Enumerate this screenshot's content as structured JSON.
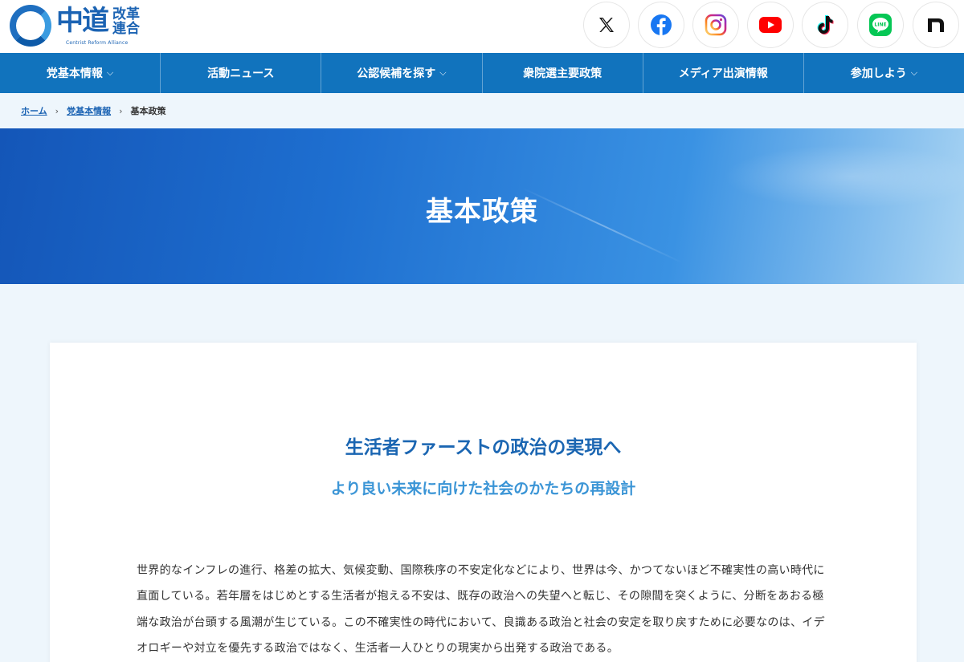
{
  "logo": {
    "main": "中道",
    "sub": "改革連合",
    "tagline": "Centrist Reform Alliance"
  },
  "social": [
    {
      "icon": "x-icon",
      "label": "X"
    },
    {
      "icon": "facebook-icon",
      "label": "Facebook"
    },
    {
      "icon": "instagram-icon",
      "label": "Instagram"
    },
    {
      "icon": "youtube-icon",
      "label": "YouTube"
    },
    {
      "icon": "tiktok-icon",
      "label": "TikTok"
    },
    {
      "icon": "line-icon",
      "label": "LINE"
    },
    {
      "icon": "note-icon",
      "label": "note"
    }
  ],
  "nav": [
    {
      "label": "党基本情報",
      "dropdown": true
    },
    {
      "label": "活動ニュース",
      "dropdown": false
    },
    {
      "label": "公認候補を探す",
      "dropdown": true
    },
    {
      "label": "衆院選主要政策",
      "dropdown": false
    },
    {
      "label": "メディア出演情報",
      "dropdown": false
    },
    {
      "label": "参加しよう",
      "dropdown": true
    }
  ],
  "breadcrumb": {
    "home": "ホーム",
    "parent": "党基本情報",
    "current": "基本政策",
    "separator": "›"
  },
  "hero": {
    "title": "基本政策"
  },
  "content": {
    "heading": "生活者ファーストの政治の実現へ",
    "subheading": "より良い未来に向けた社会のかたちの再設計",
    "paragraph": "世界的なインフレの進行、格差の拡大、気候変動、国際秩序の不安定化などにより、世界は今、かつてないほど不確実性の高い時代に直面している。若年層をはじめとする生活者が抱える不安は、既存の政治への失望へと転じ、その隙間を突くように、分断をあおる極端な政治が台頭する風潮が生じている。この不確実性の時代において、良識ある政治と社会の安定を取り戻すために必要なのは、イデオロギーや対立を優先する政治ではなく、生活者一人ひとりの現実から出発する政治である。"
  },
  "colors": {
    "brand": "#1b63b3",
    "nav_bg": "#1173bd",
    "page_bg": "#eef6fc",
    "subheading": "#3b95d6"
  }
}
